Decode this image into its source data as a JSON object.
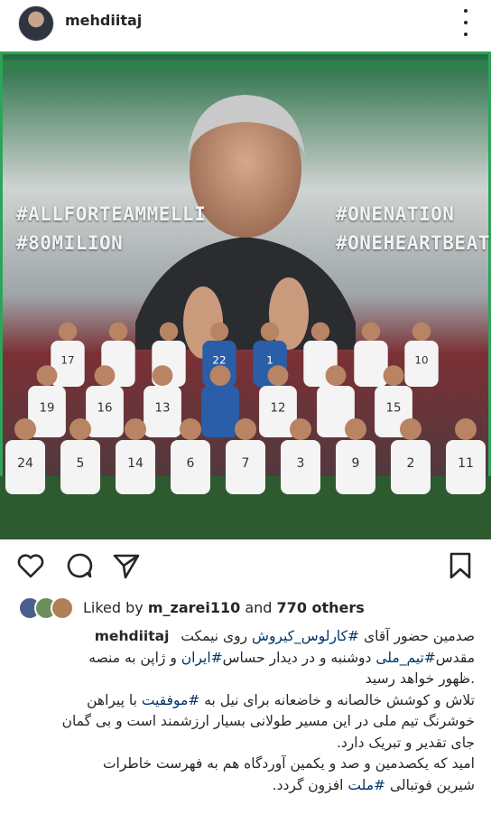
{
  "post": {
    "username": "mehdiitaj",
    "image": {
      "hashtags_left": [
        "#ALLFORTEAMMELLI",
        "#80MILION"
      ],
      "hashtags_right": [
        "#ONENATION",
        "#ONEHEARTBEAT"
      ],
      "jersey_numbers": {
        "back_row": [
          "17",
          "",
          "",
          "22",
          "1",
          "",
          "",
          "10"
        ],
        "middle_row": [
          "19",
          "16",
          "13",
          "",
          "12",
          "",
          "15"
        ],
        "front_row": [
          "24",
          "5",
          "14",
          "6",
          "7",
          "3",
          "9",
          "2",
          "11"
        ]
      }
    },
    "actions": {
      "like_icon": "heart-icon",
      "comment_icon": "comment-icon",
      "share_icon": "send-icon",
      "save_icon": "bookmark-icon"
    },
    "likes": {
      "prefix": "Liked by ",
      "user": "m_zarei110",
      "middle": " and ",
      "others": "770 others"
    },
    "caption": {
      "l1_a": "صدمین حضور آقای",
      "l1_tag": "#کارلوس_کیروش",
      "l1_b": "روی نیمکت",
      "l2_a": "مقدس",
      "l2_tag1": "#تیم_ملی",
      "l2_b": "دوشنبه و در دیدار حساس",
      "l2_tag2": "#ایران",
      "l2_c": "و ژاپن به منصه",
      "l3": ".ظهور خواهد رسید",
      "l4_a": "تلاش و کوشش خالصانه و خاضعانه برای نیل به",
      "l4_tag": "#موفقیت",
      "l4_b": "با پیراهن",
      "l5": "خوشرنگ تیم ملی در این مسیر طولانی بسیار ارزشمند است و بی گمان",
      "l6": "جای تقدیر و تبریک دارد.",
      "l7": "امید که یکصدمین و صد و یکمین آوردگاه هم به فهرست خاطرات",
      "l8_a": "شیرین فوتبالی",
      "l8_tag": "#ملت",
      "l8_b": "افزون گردد."
    }
  }
}
